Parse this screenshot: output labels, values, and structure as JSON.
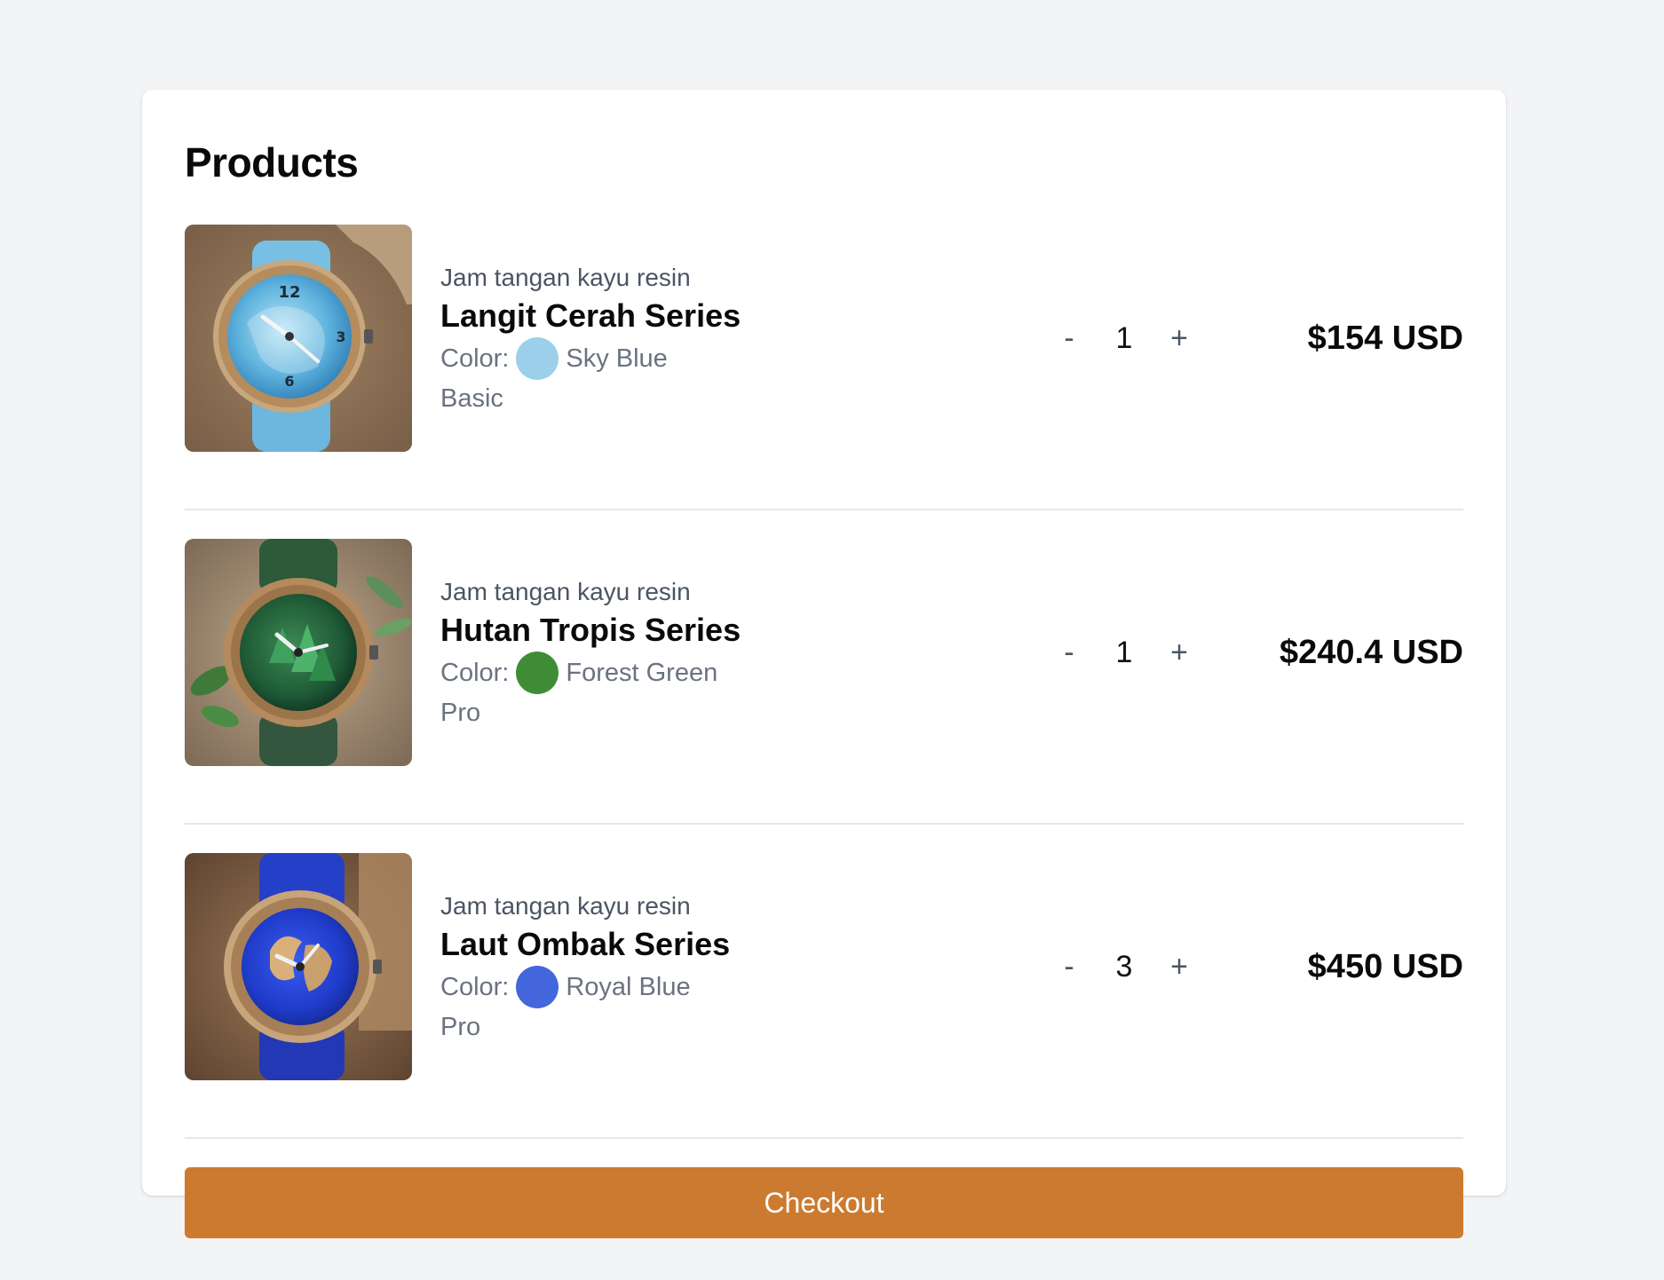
{
  "cart": {
    "title": "Products",
    "color_label": "Color:",
    "items": [
      {
        "subtitle": "Jam tangan kayu resin",
        "name": "Langit Cerah Series",
        "color_name": "Sky Blue",
        "color_hex": "#9ccfea",
        "tier": "Basic",
        "quantity": "1",
        "price": "$154 USD"
      },
      {
        "subtitle": "Jam tangan kayu resin",
        "name": "Hutan Tropis Series",
        "color_name": "Forest Green",
        "color_hex": "#3f8c36",
        "tier": "Pro",
        "quantity": "1",
        "price": "$240.4 USD"
      },
      {
        "subtitle": "Jam tangan kayu resin",
        "name": "Laut Ombak Series",
        "color_name": "Royal Blue",
        "color_hex": "#4466dd",
        "tier": "Pro",
        "quantity": "3",
        "price": "$450 USD"
      }
    ],
    "decrement_symbol": "-",
    "increment_symbol": "+",
    "checkout_label": "Checkout",
    "accent_color": "#cc7a2f"
  }
}
